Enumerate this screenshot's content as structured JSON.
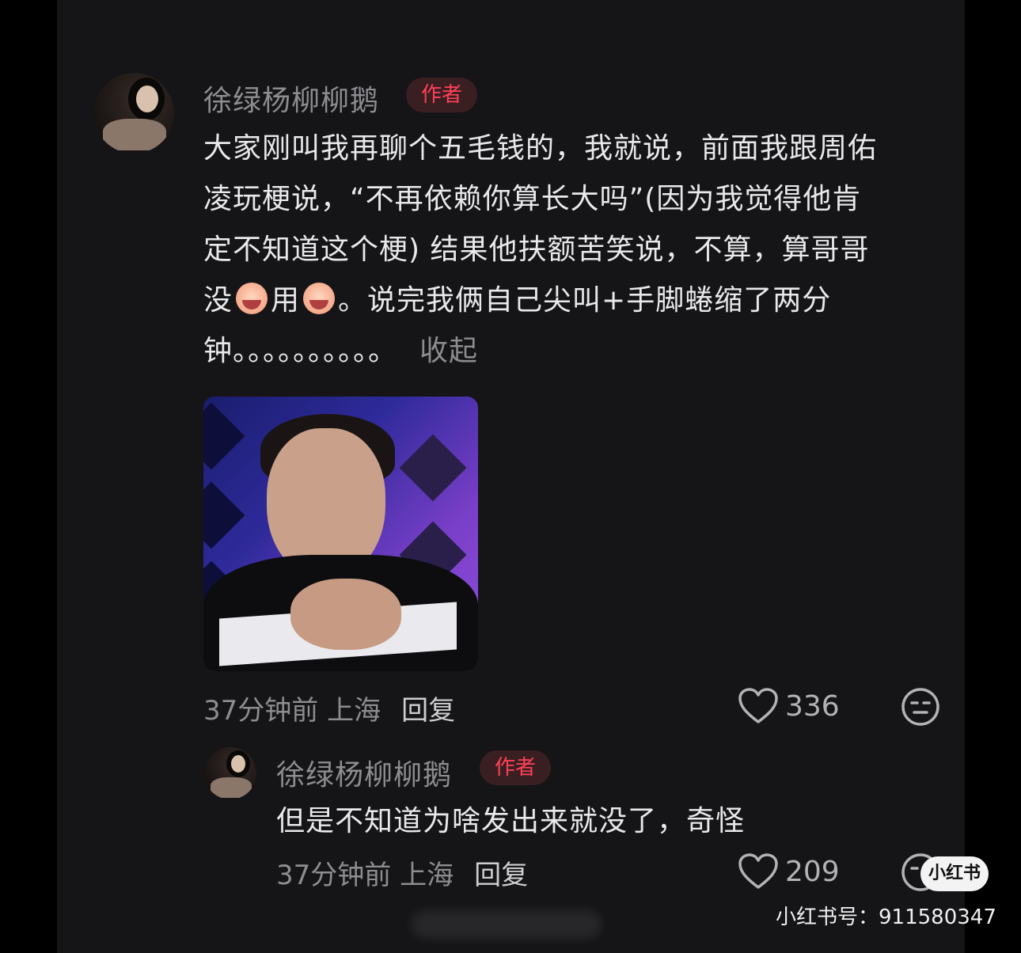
{
  "comment": {
    "username": "徐绿杨柳柳鹅",
    "badge": "作者",
    "lines": [
      "大家刚叫我再聊个五毛钱的，我就说，前面我跟周佑",
      "凌玩梗说，“不再依赖你算长大吗”(因为我觉得他肯",
      "定不知道这个梗) 结果他扶额苦笑说，不算，算哥哥"
    ],
    "line4_a": "没",
    "line4_b": "用",
    "line4_c": "。说完我俩自己尖叫+手脚蜷缩了两分",
    "line5": "钟。。。。。。。。。。",
    "emoji_name": "crying-face-emoji",
    "collapse_label": "收起",
    "meta": "37分钟前 上海",
    "reply_label": "回复",
    "like_count": "336"
  },
  "reply": {
    "username": "徐绿杨柳柳鹅",
    "badge": "作者",
    "text": "但是不知道为啥发出来就没了，奇怪",
    "meta": "37分钟前 上海",
    "reply_label": "回复",
    "like_count": "209"
  },
  "watermark": {
    "logo": "小红书",
    "id_text": "小红书号：911580347"
  },
  "colors": {
    "background": "#151416",
    "badge_text": "#ff4057",
    "badge_bg": "#3a1f22",
    "muted_text": "#8d8c90"
  }
}
